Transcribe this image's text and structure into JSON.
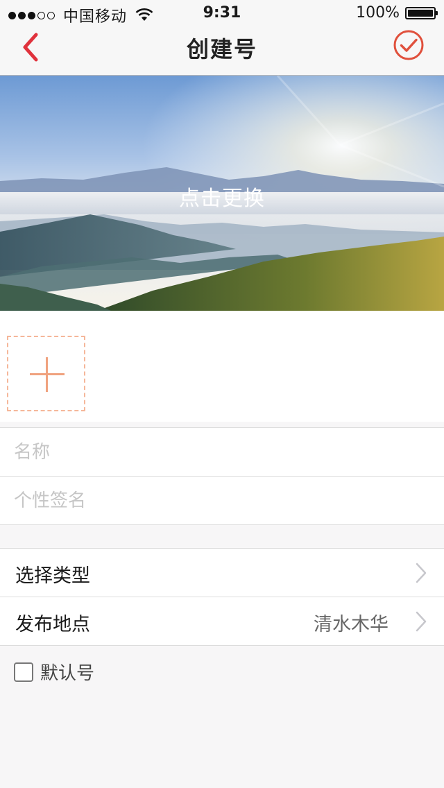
{
  "status_bar": {
    "carrier": "中国移动",
    "time": "9:31",
    "battery": "100%",
    "signal_bars_filled": 3,
    "signal_bars_total": 5
  },
  "nav": {
    "title": "创建号",
    "back_icon": "chevron-left-icon",
    "confirm_icon": "check-circle-icon",
    "accent_color": "#e0323c"
  },
  "cover": {
    "label": "点击更换"
  },
  "avatar": {
    "add_icon": "plus-icon",
    "border_color": "#f5b79a"
  },
  "form": {
    "name_placeholder": "名称",
    "signature_placeholder": "个性签名"
  },
  "options": [
    {
      "label": "选择类型",
      "value": ""
    },
    {
      "label": "发布地点",
      "value": "清水木华"
    }
  ],
  "default_checkbox": {
    "label": "默认号",
    "checked": false
  }
}
